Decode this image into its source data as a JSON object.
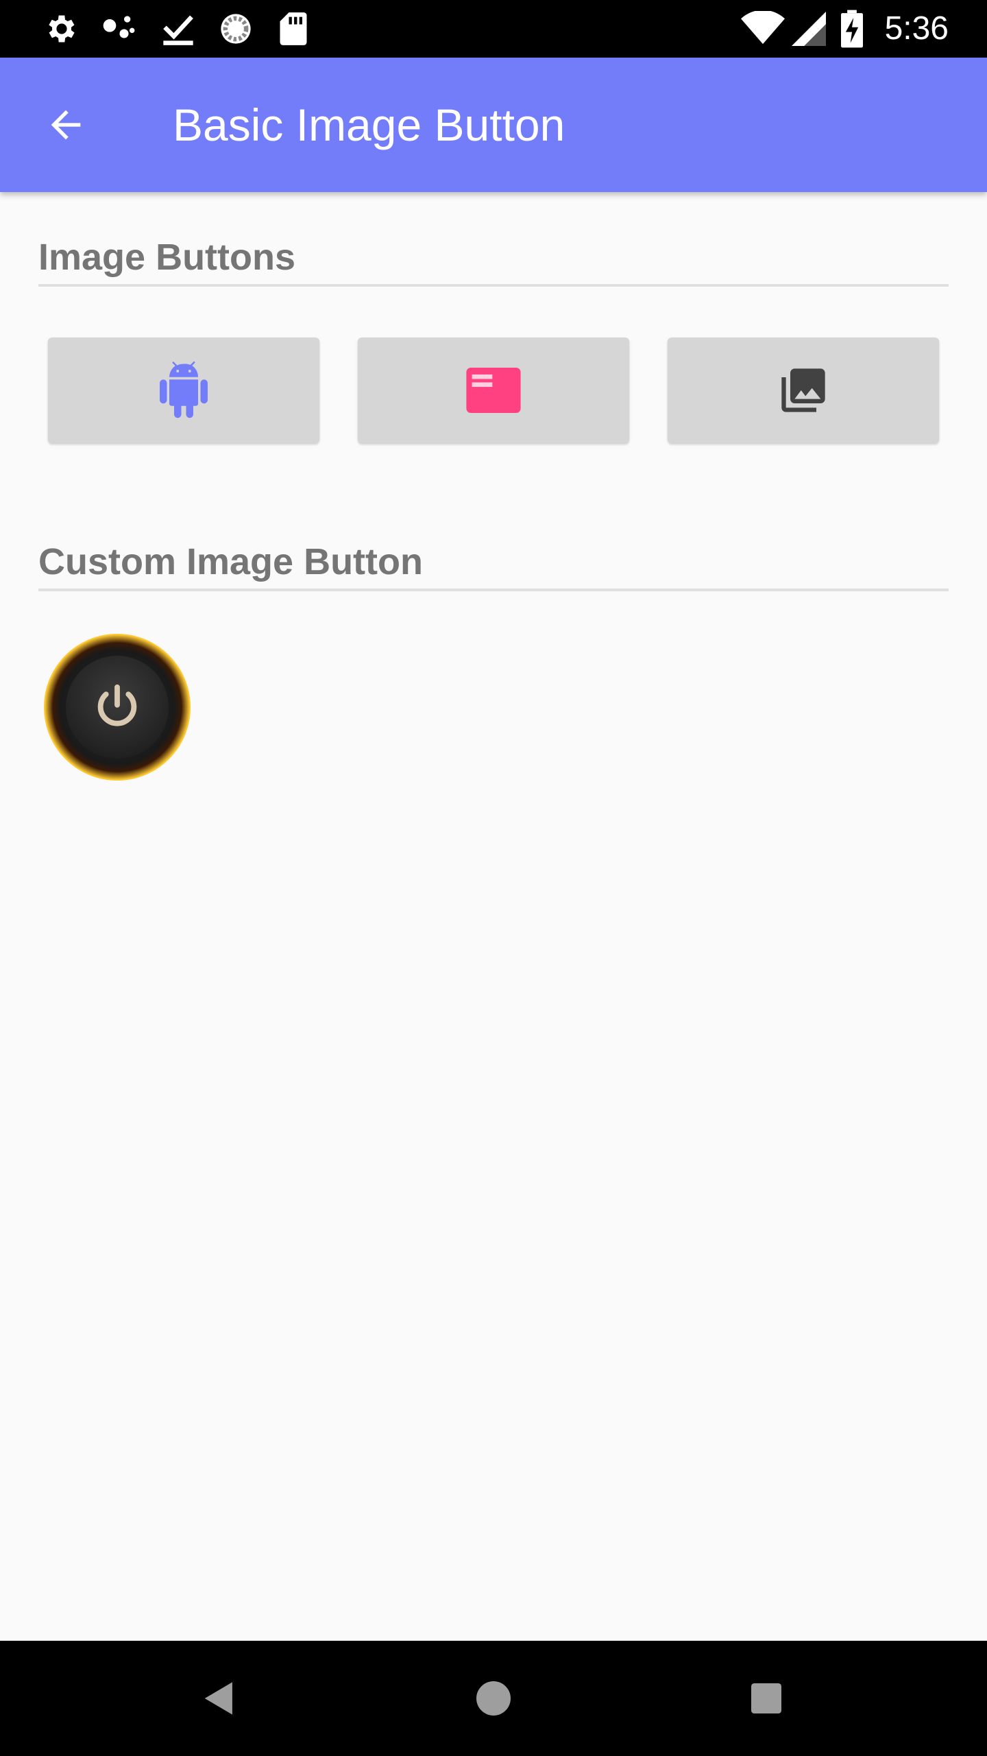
{
  "status_bar": {
    "time": "5:36",
    "left_icons": [
      "settings-icon",
      "assistant-dots-icon",
      "download-done-icon",
      "sync-circle-icon",
      "sd-card-icon"
    ],
    "right_icons": [
      "wifi-icon",
      "cell-signal-icon",
      "battery-charging-icon"
    ]
  },
  "app_bar": {
    "title": "Basic Image Button",
    "back_icon": "arrow-back-icon",
    "background_color": "#737df9"
  },
  "sections": {
    "image_buttons": {
      "title": "Image Buttons",
      "buttons": [
        {
          "icon": "android-icon",
          "color": "#737df9"
        },
        {
          "icon": "card-icon",
          "color": "#ff4081"
        },
        {
          "icon": "photo-library-icon",
          "color": "#424242"
        }
      ]
    },
    "custom_button": {
      "title": "Custom Image Button",
      "icon": "power-icon"
    }
  },
  "nav_bar": {
    "buttons": [
      "back-triangle-icon",
      "home-circle-icon",
      "recents-square-icon"
    ]
  }
}
